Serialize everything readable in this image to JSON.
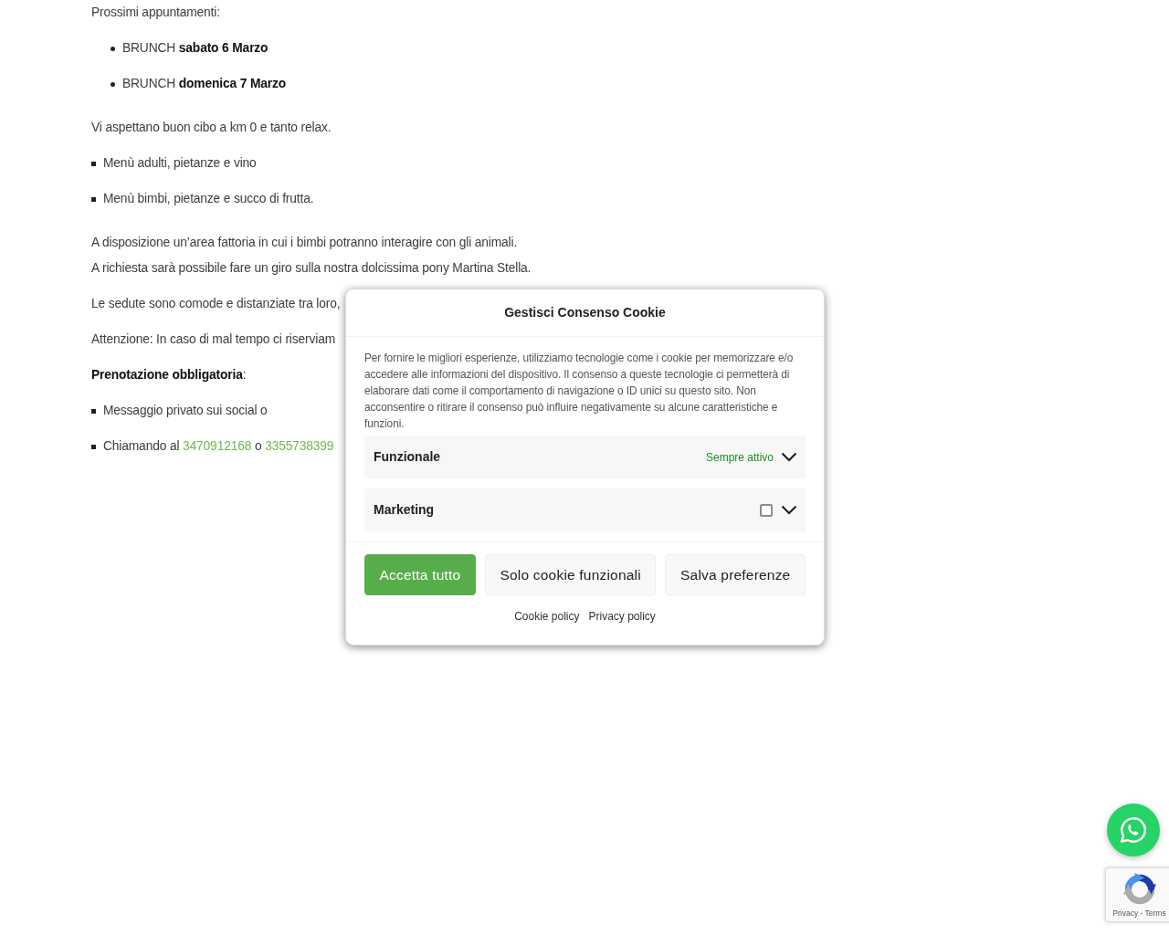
{
  "article": {
    "blocks": [
      {
        "kind": "paragraph",
        "text": "Prossimi appuntamenti:"
      },
      {
        "kind": "round_list",
        "items": [
          {
            "segments": [
              {
                "kind": "text",
                "text": "BRUNCH **sabato 6 Marzo**"
              }
            ]
          },
          {
            "segments": [
              {
                "kind": "text",
                "text": "BRUNCH **domenica 7 Marzo**"
              }
            ]
          }
        ]
      },
      {
        "kind": "paragraph",
        "text": "Vi aspettano buon cibo a km 0 e tanto relax."
      },
      {
        "kind": "square_list",
        "items": [
          {
            "segments": [
              {
                "kind": "text",
                "text": "Menù adulti, pietanze e vino"
              }
            ]
          },
          {
            "segments": [
              {
                "kind": "text",
                "text": "Menù bimbi, pietanze e succo di frutta."
              }
            ]
          }
        ]
      },
      {
        "kind": "line_group",
        "lines": [
          "A disposizione un’area fattoria in cui i bimbi potranno interagire con gli animali.",
          "A richiesta sarà possibile fare un giro sulla nostra dolcissima pony Martina Stella."
        ]
      },
      {
        "kind": "paragraph",
        "text": "Le sedute sono comode e distanziate tra loro,"
      },
      {
        "kind": "paragraph",
        "text": "Attenzione: In caso di mal tempo ci riserviam"
      },
      {
        "kind": "paragraph",
        "text": "**Prenotazione obbligatoria**:"
      },
      {
        "kind": "square_list",
        "items": [
          {
            "segments": [
              {
                "kind": "text",
                "text": "Messaggio privato sui social o"
              }
            ]
          },
          {
            "segments": [
              {
                "kind": "text",
                "text": "Chiamando al "
              },
              {
                "kind": "link",
                "text": "3470912168"
              },
              {
                "kind": "text",
                "text": " o "
              },
              {
                "kind": "link",
                "text": "3355738399"
              }
            ]
          }
        ]
      }
    ]
  },
  "cookie_dialog": {
    "title": "Gestisci Consenso Cookie",
    "description": "Per fornire le migliori esperienze, utilizziamo tecnologie come i cookie per memorizzare e/o accedere alle informazioni del dispositivo. Il consenso a queste tecnologie ci permetterà di elaborare dati come il comportamento di navigazione o ID unici su questo sito. Non acconsentire o ritirare il consenso può influire negativamente su alcune caratteristiche e funzioni.",
    "categories": [
      {
        "name": "Funzionale",
        "kind": "always_active",
        "status": "Sempre attivo",
        "expanded": false
      },
      {
        "name": "Marketing",
        "kind": "toggle",
        "checked": false,
        "expanded": false
      }
    ],
    "buttons": [
      {
        "label": "Accetta tutto",
        "primary": true
      },
      {
        "label": "Solo cookie funzionali",
        "primary": false
      },
      {
        "label": "Salva preferenze",
        "primary": false
      }
    ],
    "links": [
      "Cookie policy",
      "Privacy policy"
    ]
  },
  "captcha_badge": {
    "text": "Privacy - Terms"
  }
}
